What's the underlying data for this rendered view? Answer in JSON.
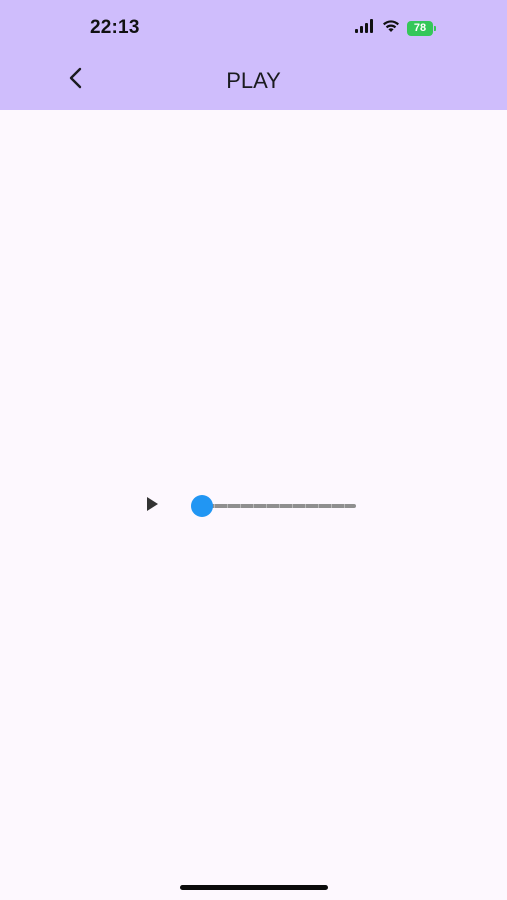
{
  "status_bar": {
    "time": "22:13",
    "battery": "78",
    "icons": [
      "signal-icon",
      "wifi-icon",
      "battery-icon"
    ]
  },
  "header": {
    "title": "PLAY",
    "back_icon": "chevron-left-icon"
  },
  "player": {
    "play_icon": "play-icon",
    "progress": 0.0
  },
  "colors": {
    "header_bg": "#cfbdfc",
    "page_bg": "#fdf8fe",
    "accent": "#2196f3",
    "battery": "#35c759"
  }
}
